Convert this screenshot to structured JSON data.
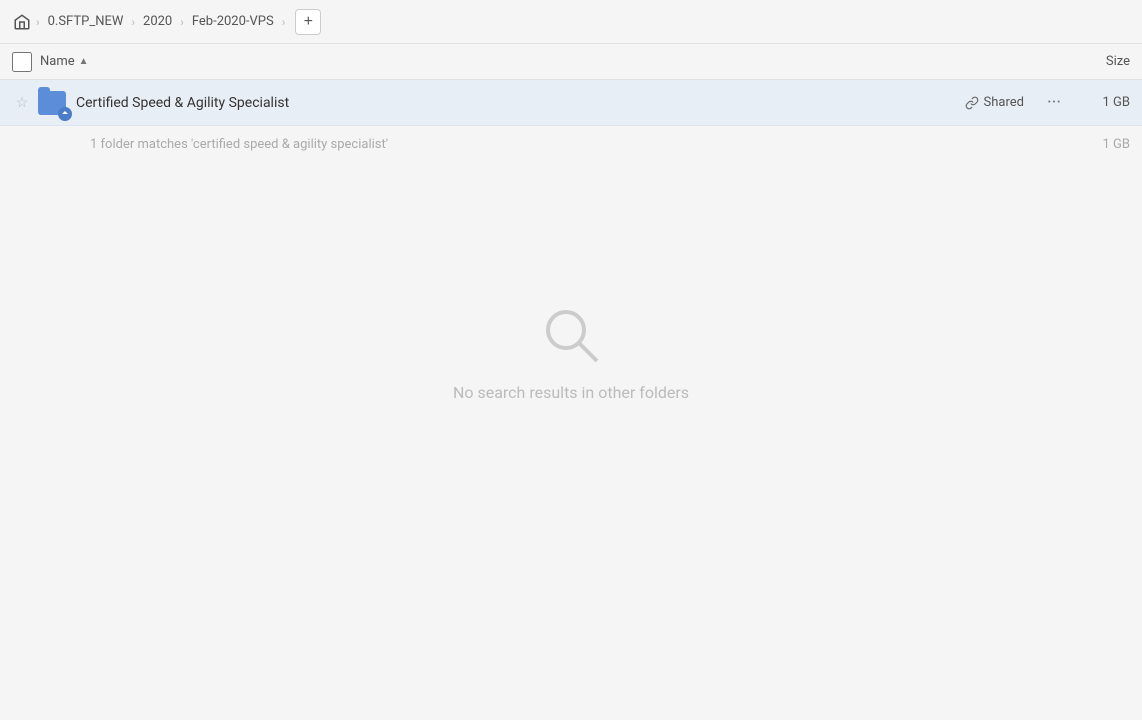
{
  "breadcrumb": {
    "home_icon": "🏠",
    "items": [
      "0.SFTP_NEW",
      "2020",
      "Feb-2020-VPS"
    ],
    "add_label": "+"
  },
  "columns": {
    "name_label": "Name",
    "size_label": "Size"
  },
  "file_row": {
    "name": "Certified Speed & Agility Specialist",
    "shared_label": "Shared",
    "size": "1 GB",
    "more_icon": "···"
  },
  "match_row": {
    "text": "1 folder matches 'certified speed & agility specialist'",
    "size": "1 GB"
  },
  "empty_state": {
    "text": "No search results in other folders"
  }
}
